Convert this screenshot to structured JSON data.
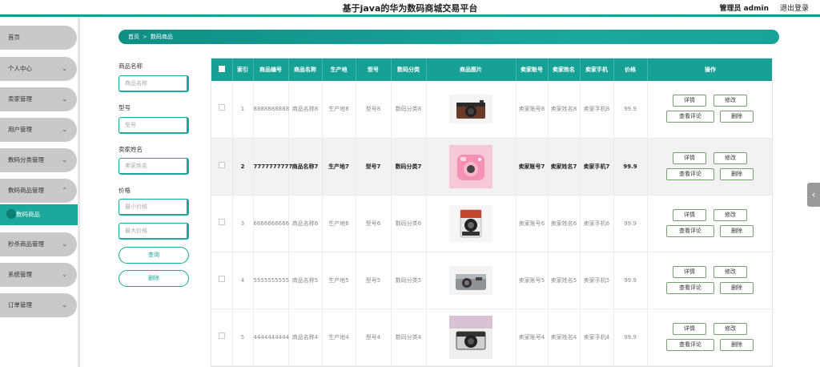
{
  "header": {
    "title": "基于java的华为数码商城交易平台",
    "admin": "管理员 admin",
    "logout": "退出登录"
  },
  "sidebar": {
    "items": [
      {
        "label": "首页",
        "chevron": ""
      },
      {
        "label": "个人中心",
        "chevron": "⌄"
      },
      {
        "label": "卖家管理",
        "chevron": "⌄"
      },
      {
        "label": "用户管理",
        "chevron": "⌄"
      },
      {
        "label": "数码分类管理",
        "chevron": "⌄"
      },
      {
        "label": "数码商品管理",
        "chevron": "⌃"
      },
      {
        "label": "秒杀商品管理",
        "chevron": "⌄"
      },
      {
        "label": "系统管理",
        "chevron": "⌄"
      },
      {
        "label": "订单管理",
        "chevron": "⌄"
      }
    ],
    "sub_item": "数码商品"
  },
  "breadcrumb": {
    "home": "首页",
    "sep": ">",
    "current": "数码商品"
  },
  "search": {
    "name_label": "商品名称",
    "name_placeholder": "商品名称",
    "model_label": "型号",
    "model_placeholder": "型号",
    "seller_label": "卖家姓名",
    "seller_placeholder": "卖家姓名",
    "price_label": "价格",
    "min_placeholder": "最小价格",
    "max_placeholder": "最大价格",
    "query_button": "查询",
    "delete_button": "删除"
  },
  "table": {
    "headers": [
      "索引",
      "商品编号",
      "商品名称",
      "生产地",
      "型号",
      "数码分类",
      "商品图片",
      "卖家账号",
      "卖家姓名",
      "卖家手机",
      "价格",
      "操作"
    ],
    "rows": [
      {
        "index": "1",
        "code": "8888888888",
        "name": "商品名称8",
        "origin": "生产地8",
        "model": "型号8",
        "category": "数码分类8",
        "account": "卖家账号8",
        "seller": "卖家姓名8",
        "phone": "卖家手机8",
        "price": "99.9",
        "image": "brown-camera"
      },
      {
        "index": "2",
        "code": "7777777777",
        "name": "商品名称7",
        "origin": "生产地7",
        "model": "型号7",
        "category": "数码分类7",
        "account": "卖家账号7",
        "seller": "卖家姓名7",
        "phone": "卖家手机7",
        "price": "99.9",
        "image": "pink-instant-camera"
      },
      {
        "index": "3",
        "code": "6666666666",
        "name": "商品名称6",
        "origin": "生产地6",
        "model": "型号6",
        "category": "数码分类6",
        "account": "卖家账号6",
        "seller": "卖家姓名6",
        "phone": "卖家手机6",
        "price": "99.9",
        "image": "instax-camera"
      },
      {
        "index": "4",
        "code": "5555555555",
        "name": "商品名称5",
        "origin": "生产地5",
        "model": "型号5",
        "category": "数码分类5",
        "account": "卖家账号5",
        "seller": "卖家姓名5",
        "phone": "卖家手机5",
        "price": "99.9",
        "image": "silver-compact-camera"
      },
      {
        "index": "5",
        "code": "4444444444",
        "name": "商品名称4",
        "origin": "生产地4",
        "model": "型号4",
        "category": "数码分类4",
        "account": "卖家账号4",
        "seller": "卖家姓名4",
        "phone": "卖家手机4",
        "price": "99.9",
        "image": "black-camera"
      }
    ],
    "ops": {
      "detail": "详情",
      "edit": "修改",
      "comments": "查看评论",
      "delete": "删除"
    }
  },
  "colors": {
    "accent": "#1aa89b",
    "sidebar": "#c9c9c9"
  }
}
